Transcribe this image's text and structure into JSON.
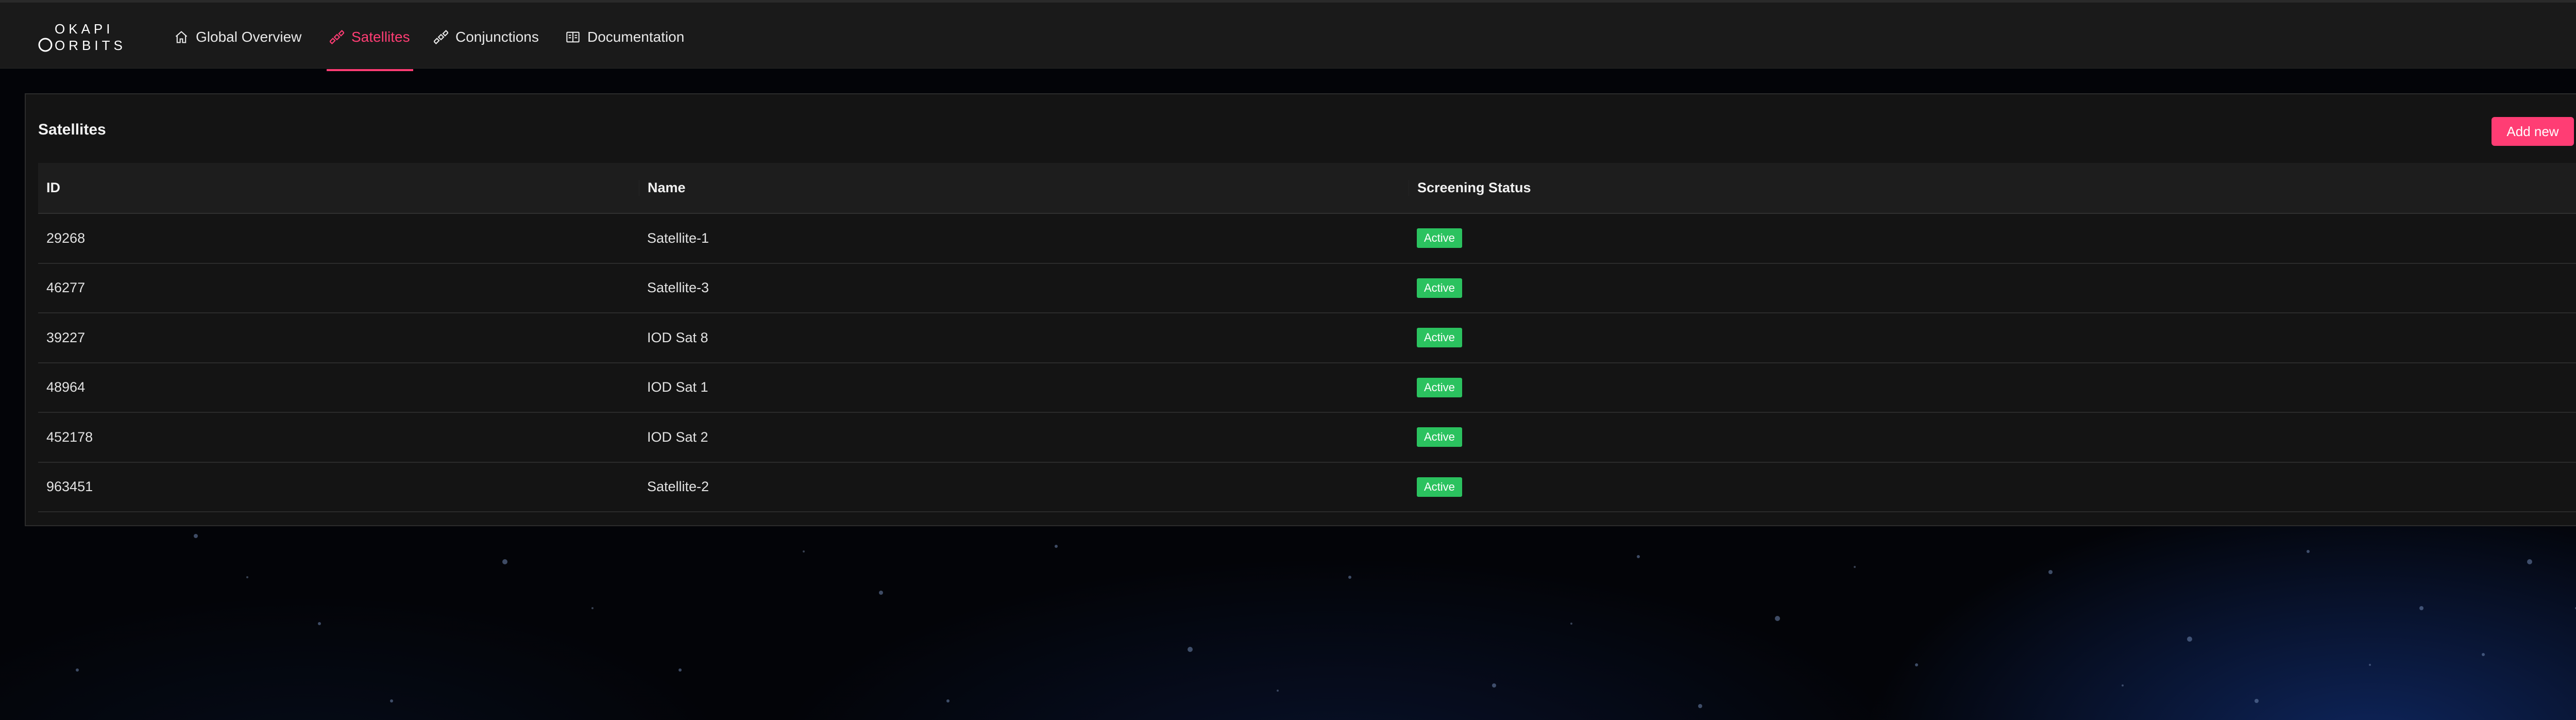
{
  "brand": {
    "line1": "OKAPI",
    "line2": "ORBITS"
  },
  "nav": {
    "items": [
      {
        "label": "Global Overview",
        "icon": "home-icon"
      },
      {
        "label": "Satellites",
        "icon": "satellite-icon",
        "active": true
      },
      {
        "label": "Conjunctions",
        "icon": "satellite-icon"
      },
      {
        "label": "Documentation",
        "icon": "book-icon"
      }
    ]
  },
  "page": {
    "title": "Satellites",
    "add_label": "Add new"
  },
  "table": {
    "headers": [
      "ID",
      "Name",
      "Screening Status"
    ],
    "rows": [
      {
        "id": "29268",
        "name": "Satellite-1",
        "status": "Active"
      },
      {
        "id": "46277",
        "name": "Satellite-3",
        "status": "Active"
      },
      {
        "id": "39227",
        "name": "IOD Sat 8",
        "status": "Active"
      },
      {
        "id": "48964",
        "name": "IOD Sat 1",
        "status": "Active"
      },
      {
        "id": "452178",
        "name": "IOD Sat 2",
        "status": "Active"
      },
      {
        "id": "963451",
        "name": "Satellite-2",
        "status": "Active"
      }
    ]
  },
  "colors": {
    "accent": "#ff3d74",
    "status_active": "#2bc25f",
    "navbar_bg": "#1a1a1a",
    "card_bg": "#141414"
  }
}
